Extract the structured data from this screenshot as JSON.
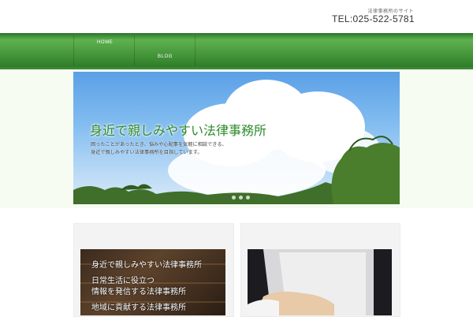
{
  "header": {
    "tagline": "法律事務所のサイト",
    "tel": "TEL:025-522-5781"
  },
  "nav": {
    "items": [
      {
        "label": "HOME"
      },
      {
        "label": "BLOG"
      }
    ]
  },
  "hero": {
    "title": "身近で親しみやすい法律事務所",
    "sub_line1": "困ったことがあったとき、悩みや心配事を気軽に相談できる、",
    "sub_line2": "身近で親しみやすい法律事務所を目指しています。",
    "slide_count": 4,
    "active_slide": 0
  },
  "cards": {
    "left": {
      "line1": "身近で親しみやすい法律事務所",
      "line2": "日常生活に役立つ",
      "line3": "情報を発信する法律事務所",
      "line4": "地域に貢献する法律事務所"
    }
  },
  "colors": {
    "nav_green": "#4c9e40",
    "title_green": "#2f8a2c"
  }
}
